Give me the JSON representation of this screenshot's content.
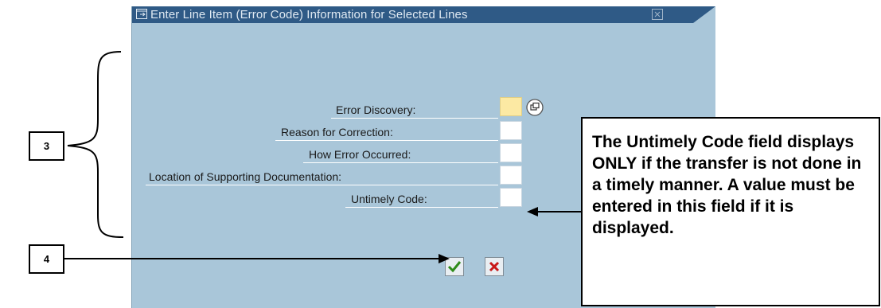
{
  "dialog": {
    "title": "Enter Line Item (Error Code) Information for Selected Lines",
    "title_icon": "dialog-icon",
    "close_icon": "close-icon",
    "fields": [
      {
        "label": "Error Discovery:",
        "value": "",
        "required": true
      },
      {
        "label": "Reason for Correction:",
        "value": ""
      },
      {
        "label": "How Error Occurred:",
        "value": ""
      },
      {
        "label": "Location of Supporting Documentation:",
        "value": ""
      },
      {
        "label": "Untimely Code:",
        "value": ""
      }
    ],
    "possible_entries_icon": "f4-help-icon",
    "confirm_icon": "checkmark-icon",
    "cancel_icon": "x-icon"
  },
  "callout": {
    "text": "The Untimely Code field displays ONLY if the transfer is not done in a timely manner.  A value must be entered in this field if it is displayed."
  },
  "steps": {
    "step3": "3",
    "step4": "4"
  },
  "colors": {
    "dialog_bg": "#a9c6d9",
    "titlebar": "#2f5a86",
    "required_field": "#fce9a3"
  }
}
